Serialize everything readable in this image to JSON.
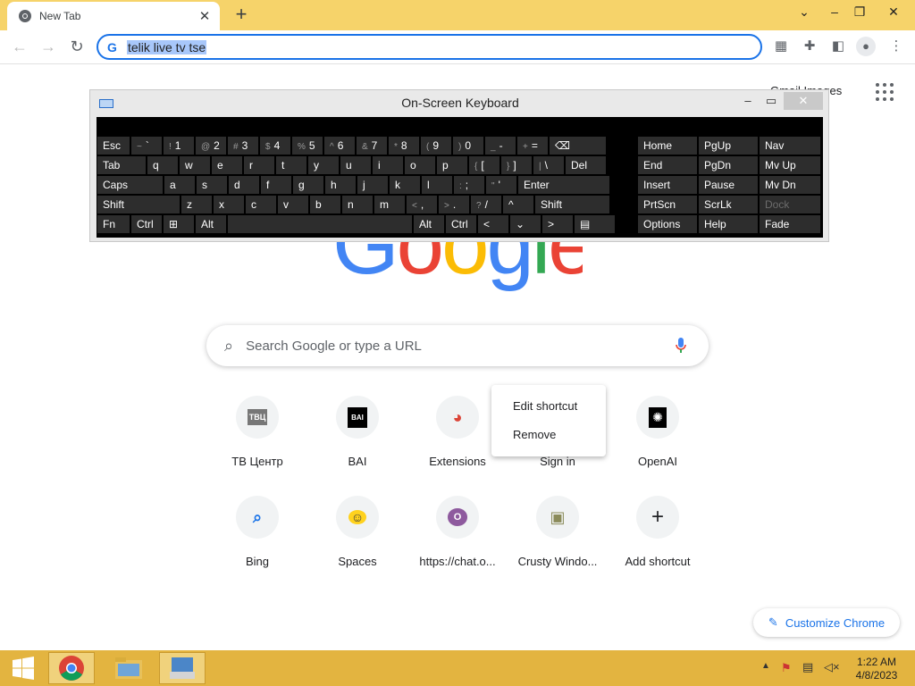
{
  "browser": {
    "tab_title": "New Tab",
    "new_tab_glyph": "+",
    "omnibox_text": "telik live tv tse",
    "window_controls": [
      "⌄",
      "–",
      "❐",
      "✕"
    ]
  },
  "page": {
    "gmail_label": "Gmail  Images",
    "search_placeholder": "Search Google or type a URL",
    "logo_letters": [
      "G",
      "o",
      "o",
      "g",
      "l",
      "e"
    ],
    "logo_colors": [
      "#4285f4",
      "#ea4335",
      "#fbbc05",
      "#4285f4",
      "#34a853",
      "#ea4335"
    ],
    "shortcuts_row1": [
      {
        "label": "ТВ Центр",
        "icon": "tvc-logo",
        "glyph": "ТВЦ"
      },
      {
        "label": "BAI",
        "icon": "bai-logo",
        "glyph": "BAI"
      },
      {
        "label": "Extensions",
        "icon": "chrome-logo",
        "glyph": "◕"
      },
      {
        "label": "Sign in",
        "icon": "signin-icon",
        "glyph": ""
      },
      {
        "label": "OpenAI",
        "icon": "openai-logo",
        "glyph": "✺"
      }
    ],
    "shortcuts_row2": [
      {
        "label": "Bing",
        "icon": "search-icon",
        "glyph": "⌕"
      },
      {
        "label": "Spaces",
        "icon": "hugging-face-icon",
        "glyph": "☺"
      },
      {
        "label": "https://chat.o...",
        "icon": "o-letter-icon",
        "glyph": "O"
      },
      {
        "label": "Crusty Windo...",
        "icon": "crusty-icon",
        "glyph": "▣"
      },
      {
        "label": "Add shortcut",
        "icon": "plus-icon",
        "glyph": "+"
      }
    ],
    "context_menu": [
      "Edit shortcut",
      "Remove"
    ],
    "customize_label": "Customize Chrome"
  },
  "osk": {
    "title": "On-Screen Keyboard",
    "rows": [
      [
        {
          "t": "Esc",
          "w": 38
        },
        {
          "s": "~",
          "t": "`",
          "w": 36
        },
        {
          "s": "!",
          "t": "1",
          "w": 36
        },
        {
          "s": "@",
          "t": "2",
          "w": 36
        },
        {
          "s": "#",
          "t": "3",
          "w": 36
        },
        {
          "s": "$",
          "t": "4",
          "w": 36
        },
        {
          "s": "%",
          "t": "5",
          "w": 36
        },
        {
          "s": "^",
          "t": "6",
          "w": 36
        },
        {
          "s": "&",
          "t": "7",
          "w": 36
        },
        {
          "s": "*",
          "t": "8",
          "w": 36
        },
        {
          "s": "(",
          "t": "9",
          "w": 36
        },
        {
          "s": ")",
          "t": "0",
          "w": 36
        },
        {
          "s": "_",
          "t": "-",
          "w": 36
        },
        {
          "s": "+",
          "t": "=",
          "w": 36
        },
        {
          "t": "⌫",
          "w": 65
        }
      ],
      [
        {
          "t": "Tab",
          "w": 56
        },
        {
          "t": "q",
          "w": 36
        },
        {
          "t": "w",
          "w": 36
        },
        {
          "t": "e",
          "w": 36
        },
        {
          "t": "r",
          "w": 36
        },
        {
          "t": "t",
          "w": 36
        },
        {
          "t": "y",
          "w": 36
        },
        {
          "t": "u",
          "w": 36
        },
        {
          "t": "i",
          "w": 36
        },
        {
          "t": "o",
          "w": 36
        },
        {
          "t": "p",
          "w": 36
        },
        {
          "s": "{",
          "t": "[",
          "w": 36
        },
        {
          "s": "}",
          "t": "]",
          "w": 36
        },
        {
          "s": "|",
          "t": "\\",
          "w": 36
        },
        {
          "t": "Del",
          "w": 47
        }
      ],
      [
        {
          "t": "Caps",
          "w": 75
        },
        {
          "t": "a",
          "w": 36
        },
        {
          "t": "s",
          "w": 36
        },
        {
          "t": "d",
          "w": 36
        },
        {
          "t": "f",
          "w": 36
        },
        {
          "t": "g",
          "w": 36
        },
        {
          "t": "h",
          "w": 36
        },
        {
          "t": "j",
          "w": 36
        },
        {
          "t": "k",
          "w": 36
        },
        {
          "t": "l",
          "w": 36
        },
        {
          "s": ":",
          "t": ";",
          "w": 36
        },
        {
          "s": "\"",
          "t": "'",
          "w": 36
        },
        {
          "t": "Enter",
          "w": 104
        }
      ],
      [
        {
          "t": "Shift",
          "w": 94
        },
        {
          "t": "z",
          "w": 36
        },
        {
          "t": "x",
          "w": 36
        },
        {
          "t": "c",
          "w": 36
        },
        {
          "t": "v",
          "w": 36
        },
        {
          "t": "b",
          "w": 36
        },
        {
          "t": "n",
          "w": 36
        },
        {
          "t": "m",
          "w": 36
        },
        {
          "s": "<",
          "t": ",",
          "w": 36
        },
        {
          "s": ">",
          "t": ".",
          "w": 36
        },
        {
          "s": "?",
          "t": "/",
          "w": 36
        },
        {
          "t": "^",
          "w": 36
        },
        {
          "t": "Shift",
          "w": 85
        }
      ],
      [
        {
          "t": "Fn",
          "w": 38
        },
        {
          "t": "Ctrl",
          "w": 36
        },
        {
          "t": "⊞",
          "w": 36
        },
        {
          "t": "Alt",
          "w": 36
        },
        {
          "t": "",
          "w": 208
        },
        {
          "t": "Alt",
          "w": 36
        },
        {
          "t": "Ctrl",
          "w": 36
        },
        {
          "t": "<",
          "w": 36
        },
        {
          "t": "⌄",
          "w": 36
        },
        {
          "t": ">",
          "w": 36
        },
        {
          "t": "▤",
          "w": 47
        }
      ]
    ],
    "side": [
      [
        {
          "t": "Home"
        },
        {
          "t": "PgUp"
        },
        {
          "t": "Nav"
        }
      ],
      [
        {
          "t": "End"
        },
        {
          "t": "PgDn"
        },
        {
          "t": "Mv Up"
        }
      ],
      [
        {
          "t": "Insert"
        },
        {
          "t": "Pause"
        },
        {
          "t": "Mv Dn"
        }
      ],
      [
        {
          "t": "PrtScn"
        },
        {
          "t": "ScrLk"
        },
        {
          "t": "Dock",
          "dim": true
        }
      ],
      [
        {
          "t": "Options"
        },
        {
          "t": "Help"
        },
        {
          "t": "Fade"
        }
      ]
    ]
  },
  "taskbar": {
    "time": "1:22 AM",
    "date": "4/8/2023"
  }
}
